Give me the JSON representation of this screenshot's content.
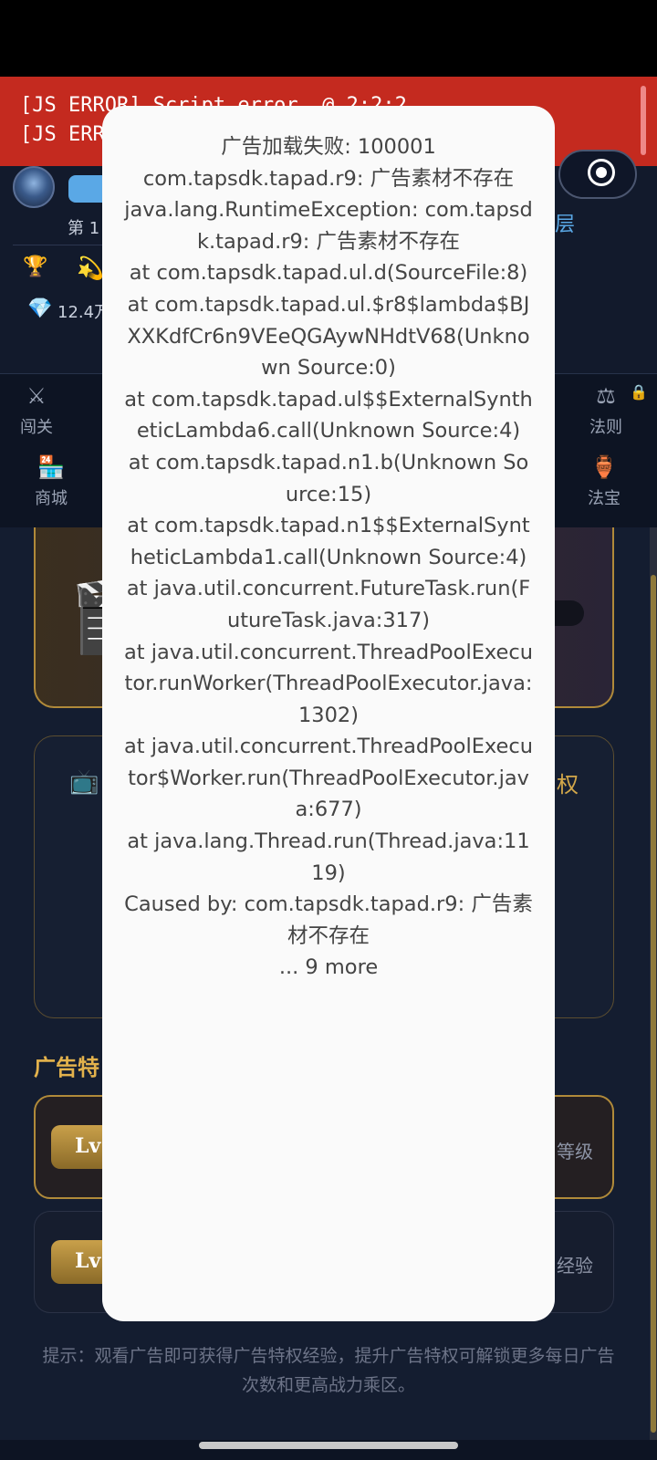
{
  "error_banner": {
    "lines": [
      "[JS ERROR] Script error. @ 2:2:2",
      "[JS ERROR] Script error. @ 2:2:2"
    ],
    "color": "#c42a1f"
  },
  "header": {
    "level_label": "第 1",
    "floor_label": "层",
    "gem_value": "12.4万",
    "icons": [
      "trophy-icon",
      "sparkle-icon",
      "gem-icon"
    ]
  },
  "nav": {
    "items": [
      {
        "label": "闯关",
        "icon": "⚔"
      },
      {
        "label": "法则",
        "icon": "⚖"
      },
      {
        "label": "商城",
        "icon": "🏪"
      },
      {
        "label": "法宝",
        "icon": "🏺"
      }
    ]
  },
  "cards": {
    "quan_text": "权"
  },
  "ad_privilege": {
    "section_title": "广告特",
    "rows": [
      {
        "badge": "Lv",
        "right_text": "等级"
      },
      {
        "badge": "Lv",
        "right_text": "经验"
      }
    ],
    "tip": "提示：观看广告即可获得广告特权经验，提升广告特权可解锁更多每日广告次数和更高战力乘区。"
  },
  "dialog": {
    "lines": [
      "广告加载失败: 100001",
      "com.tapsdk.tapad.r9: 广告素材不存在",
      "java.lang.RuntimeException: com.tapsdk.tapad.r9: 广告素材不存在",
      "at com.tapsdk.tapad.ul.d(SourceFile:8)",
      "at com.tapsdk.tapad.ul.$r8$lambda$BJXXKdfCr6n9VEeQGAywNHdtV68(Unknown Source:0)",
      "at com.tapsdk.tapad.ul$$ExternalSyntheticLambda6.call(Unknown Source:4)",
      "at com.tapsdk.tapad.n1.b(Unknown Source:15)",
      "at com.tapsdk.tapad.n1$$ExternalSyntheticLambda1.call(Unknown Source:4)",
      "at java.util.concurrent.FutureTask.run(FutureTask.java:317)",
      "at java.util.concurrent.ThreadPoolExecutor.runWorker(ThreadPoolExecutor.java:1302)",
      "at java.util.concurrent.ThreadPoolExecutor$Worker.run(ThreadPoolExecutor.java:677)",
      "at java.lang.Thread.run(Thread.java:1119)",
      "Caused by: com.tapsdk.tapad.r9: 广告素材不存在",
      "... 9 more"
    ]
  }
}
